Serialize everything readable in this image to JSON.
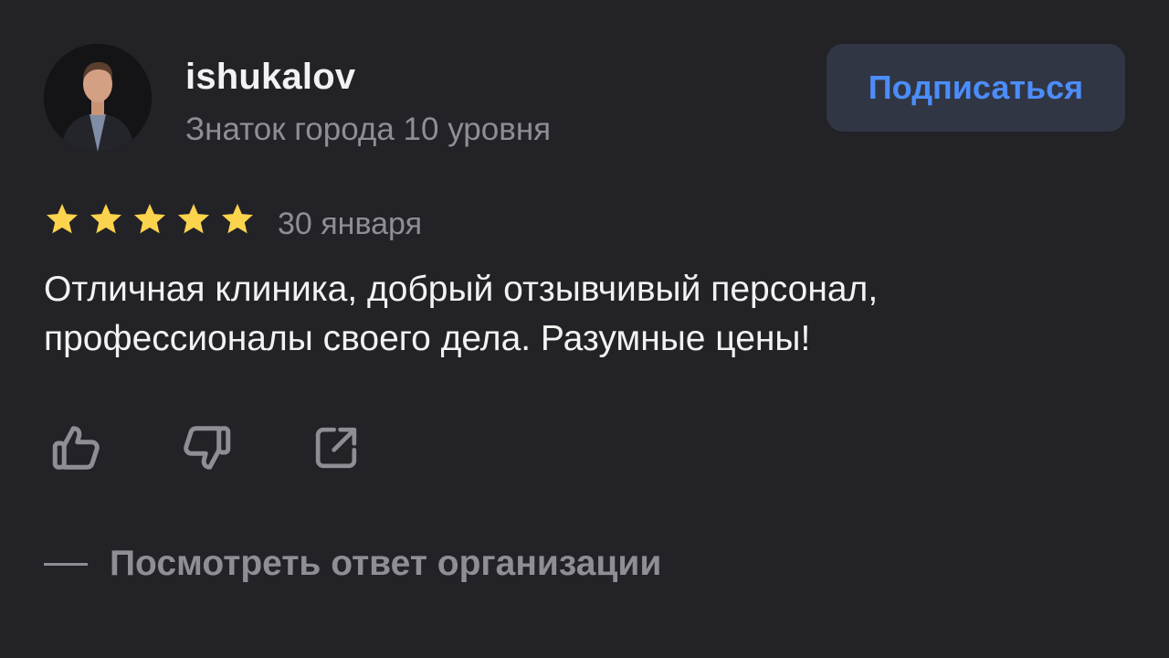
{
  "user": {
    "name": "ishukalov",
    "level": "Знаток города 10 уровня",
    "avatar_icon": "user-photo"
  },
  "subscribe": {
    "label": "Подписаться"
  },
  "review": {
    "rating": 5,
    "rating_max": 5,
    "date": "30 января",
    "text": "Отличная клиника, добрый отзывчивый персонал, профессионалы своего дела. Разумные цены!"
  },
  "actions": {
    "like_icon": "thumbs-up-icon",
    "dislike_icon": "thumbs-down-icon",
    "share_icon": "share-icon"
  },
  "org_reply": {
    "label": "Посмотреть ответ организации"
  },
  "colors": {
    "background": "#222227",
    "text_primary": "#f2f2f2",
    "text_secondary": "#8e8e94",
    "accent": "#4c8dfa",
    "button_bg": "#313645",
    "star": "#fcd34d"
  }
}
